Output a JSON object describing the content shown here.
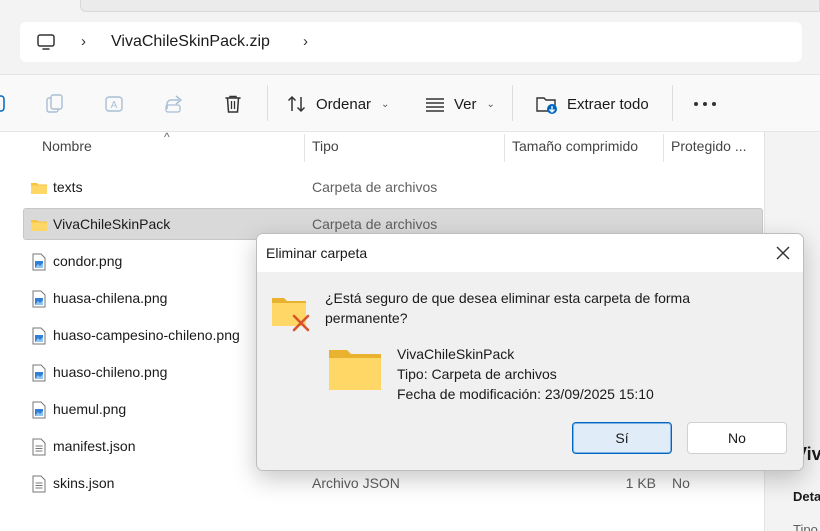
{
  "address": {
    "crumb": "VivaChileSkinPack.zip"
  },
  "toolbar": {
    "sort_label": "Ordenar",
    "view_label": "Ver",
    "extract_label": "Extraer todo",
    "icons": [
      "copy-icon",
      "rename-icon",
      "share-icon",
      "delete-icon",
      "sort-icon",
      "view-icon",
      "extract-icon",
      "more-icon"
    ]
  },
  "columns": {
    "name": "Nombre",
    "type": "Tipo",
    "compressed_size": "Tamaño comprimido",
    "protected": "Protegido ..."
  },
  "files": [
    {
      "name": "texts",
      "type": "Carpeta de archivos",
      "size": "",
      "protected": "",
      "icon": "folder-icon"
    },
    {
      "name": "VivaChileSkinPack",
      "type": "Carpeta de archivos",
      "size": "",
      "protected": "",
      "icon": "folder-icon",
      "selected": true
    },
    {
      "name": "condor.png",
      "type": "",
      "size": "",
      "protected": "",
      "icon": "image-file-icon"
    },
    {
      "name": "huasa-chilena.png",
      "type": "",
      "size": "",
      "protected": "",
      "icon": "image-file-icon"
    },
    {
      "name": "huaso-campesino-chileno.png",
      "type": "",
      "size": "",
      "protected": "",
      "icon": "image-file-icon"
    },
    {
      "name": "huaso-chileno.png",
      "type": "",
      "size": "",
      "protected": "",
      "icon": "image-file-icon"
    },
    {
      "name": "huemul.png",
      "type": "",
      "size": "",
      "protected": "",
      "icon": "image-file-icon"
    },
    {
      "name": "manifest.json",
      "type": "",
      "size": "",
      "protected": "",
      "icon": "text-file-icon"
    },
    {
      "name": "skins.json",
      "type": "Archivo JSON",
      "size": "1 KB",
      "protected": "No",
      "icon": "text-file-icon"
    }
  ],
  "details_pane": {
    "title": "Viva",
    "section": "Deta",
    "field": "Tipo"
  },
  "dialog": {
    "title": "Eliminar carpeta",
    "question": "¿Está seguro de que desea eliminar esta carpeta de forma permanente?",
    "item_name": "VivaChileSkinPack",
    "item_type": "Tipo: Carpeta de archivos",
    "item_modified": "Fecha de modificación: 23/09/2025 15:10",
    "yes_label": "Sí",
    "no_label": "No"
  },
  "colors": {
    "accent": "#0067c0",
    "folder": "#f6c343",
    "selected_row": "#d9d9d9",
    "delete_x": "#d9532c"
  }
}
